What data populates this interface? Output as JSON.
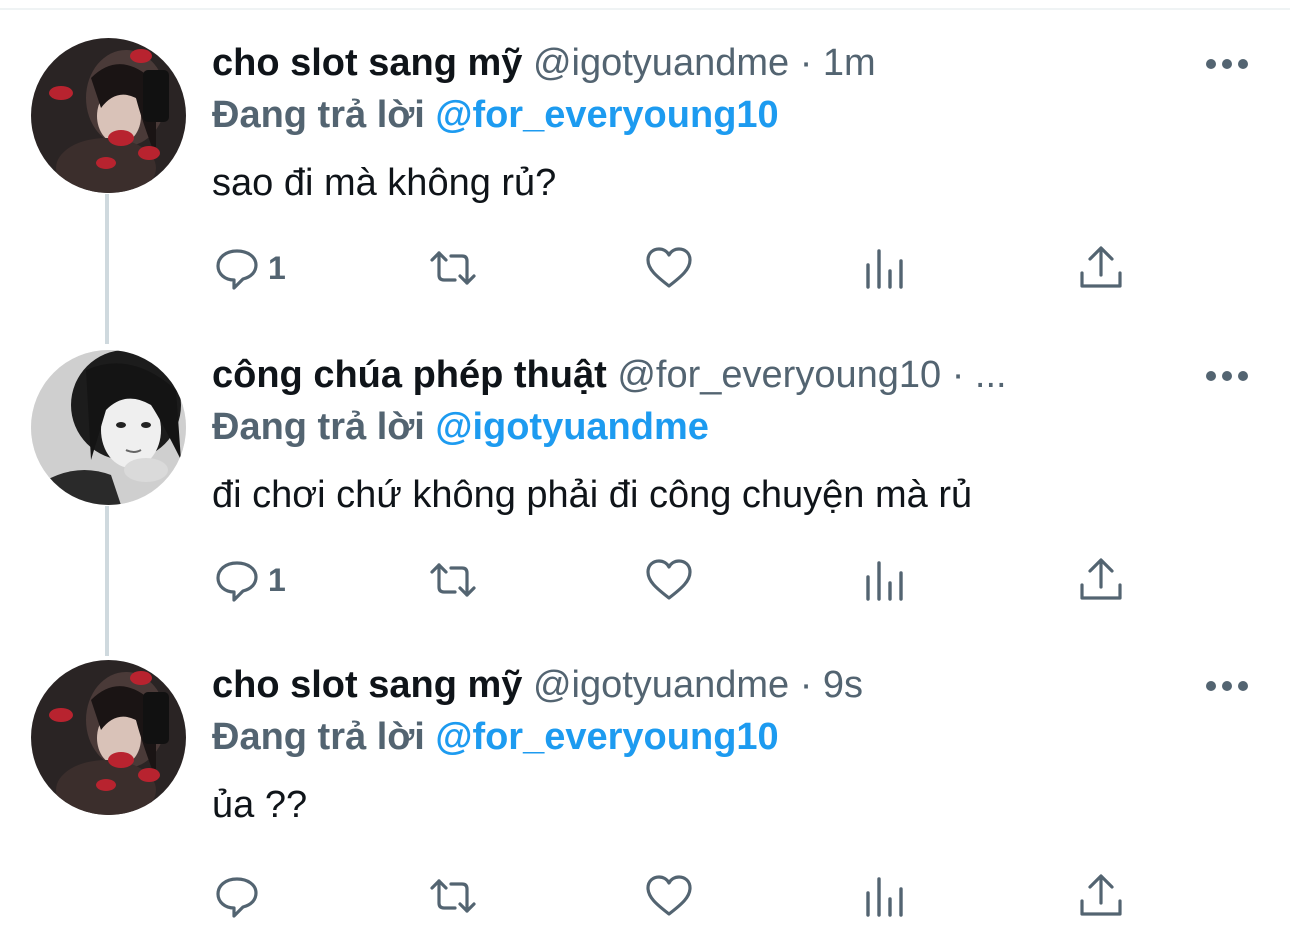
{
  "colors": {
    "primary_text": "#0f1419",
    "secondary_text": "#536471",
    "accent": "#1d9bf0",
    "thread_line": "#cfd9de"
  },
  "tweets": [
    {
      "display_name": "cho slot sang mỹ",
      "handle": "@igotyuandme",
      "separator": "·",
      "time": "1m",
      "reply_prefix": "Đang trả lời",
      "reply_to": "@for_everyoung10",
      "text": "sao đi mà không rủ?",
      "reply_count": "1",
      "avatar_icon": "avatar-photo-icon",
      "more_icon": "more-dots-icon"
    },
    {
      "display_name": "công chúa phép thuật",
      "handle": "@for_everyoung10",
      "separator": "·",
      "time": "...",
      "reply_prefix": "Đang trả lời",
      "reply_to": "@igotyuandme",
      "text": "đi chơi chứ không phải đi công chuyện mà rủ",
      "reply_count": "1",
      "avatar_icon": "avatar-photo-icon",
      "more_icon": "more-dots-icon"
    },
    {
      "display_name": "cho slot sang mỹ",
      "handle": "@igotyuandme",
      "separator": "·",
      "time": "9s",
      "reply_prefix": "Đang trả lời",
      "reply_to": "@for_everyoung10",
      "text": "ủa ??",
      "reply_count": "",
      "avatar_icon": "avatar-photo-icon",
      "more_icon": "more-dots-icon"
    }
  ],
  "action_icons": [
    "reply-icon",
    "retweet-icon",
    "like-icon",
    "analytics-icon",
    "share-icon"
  ]
}
